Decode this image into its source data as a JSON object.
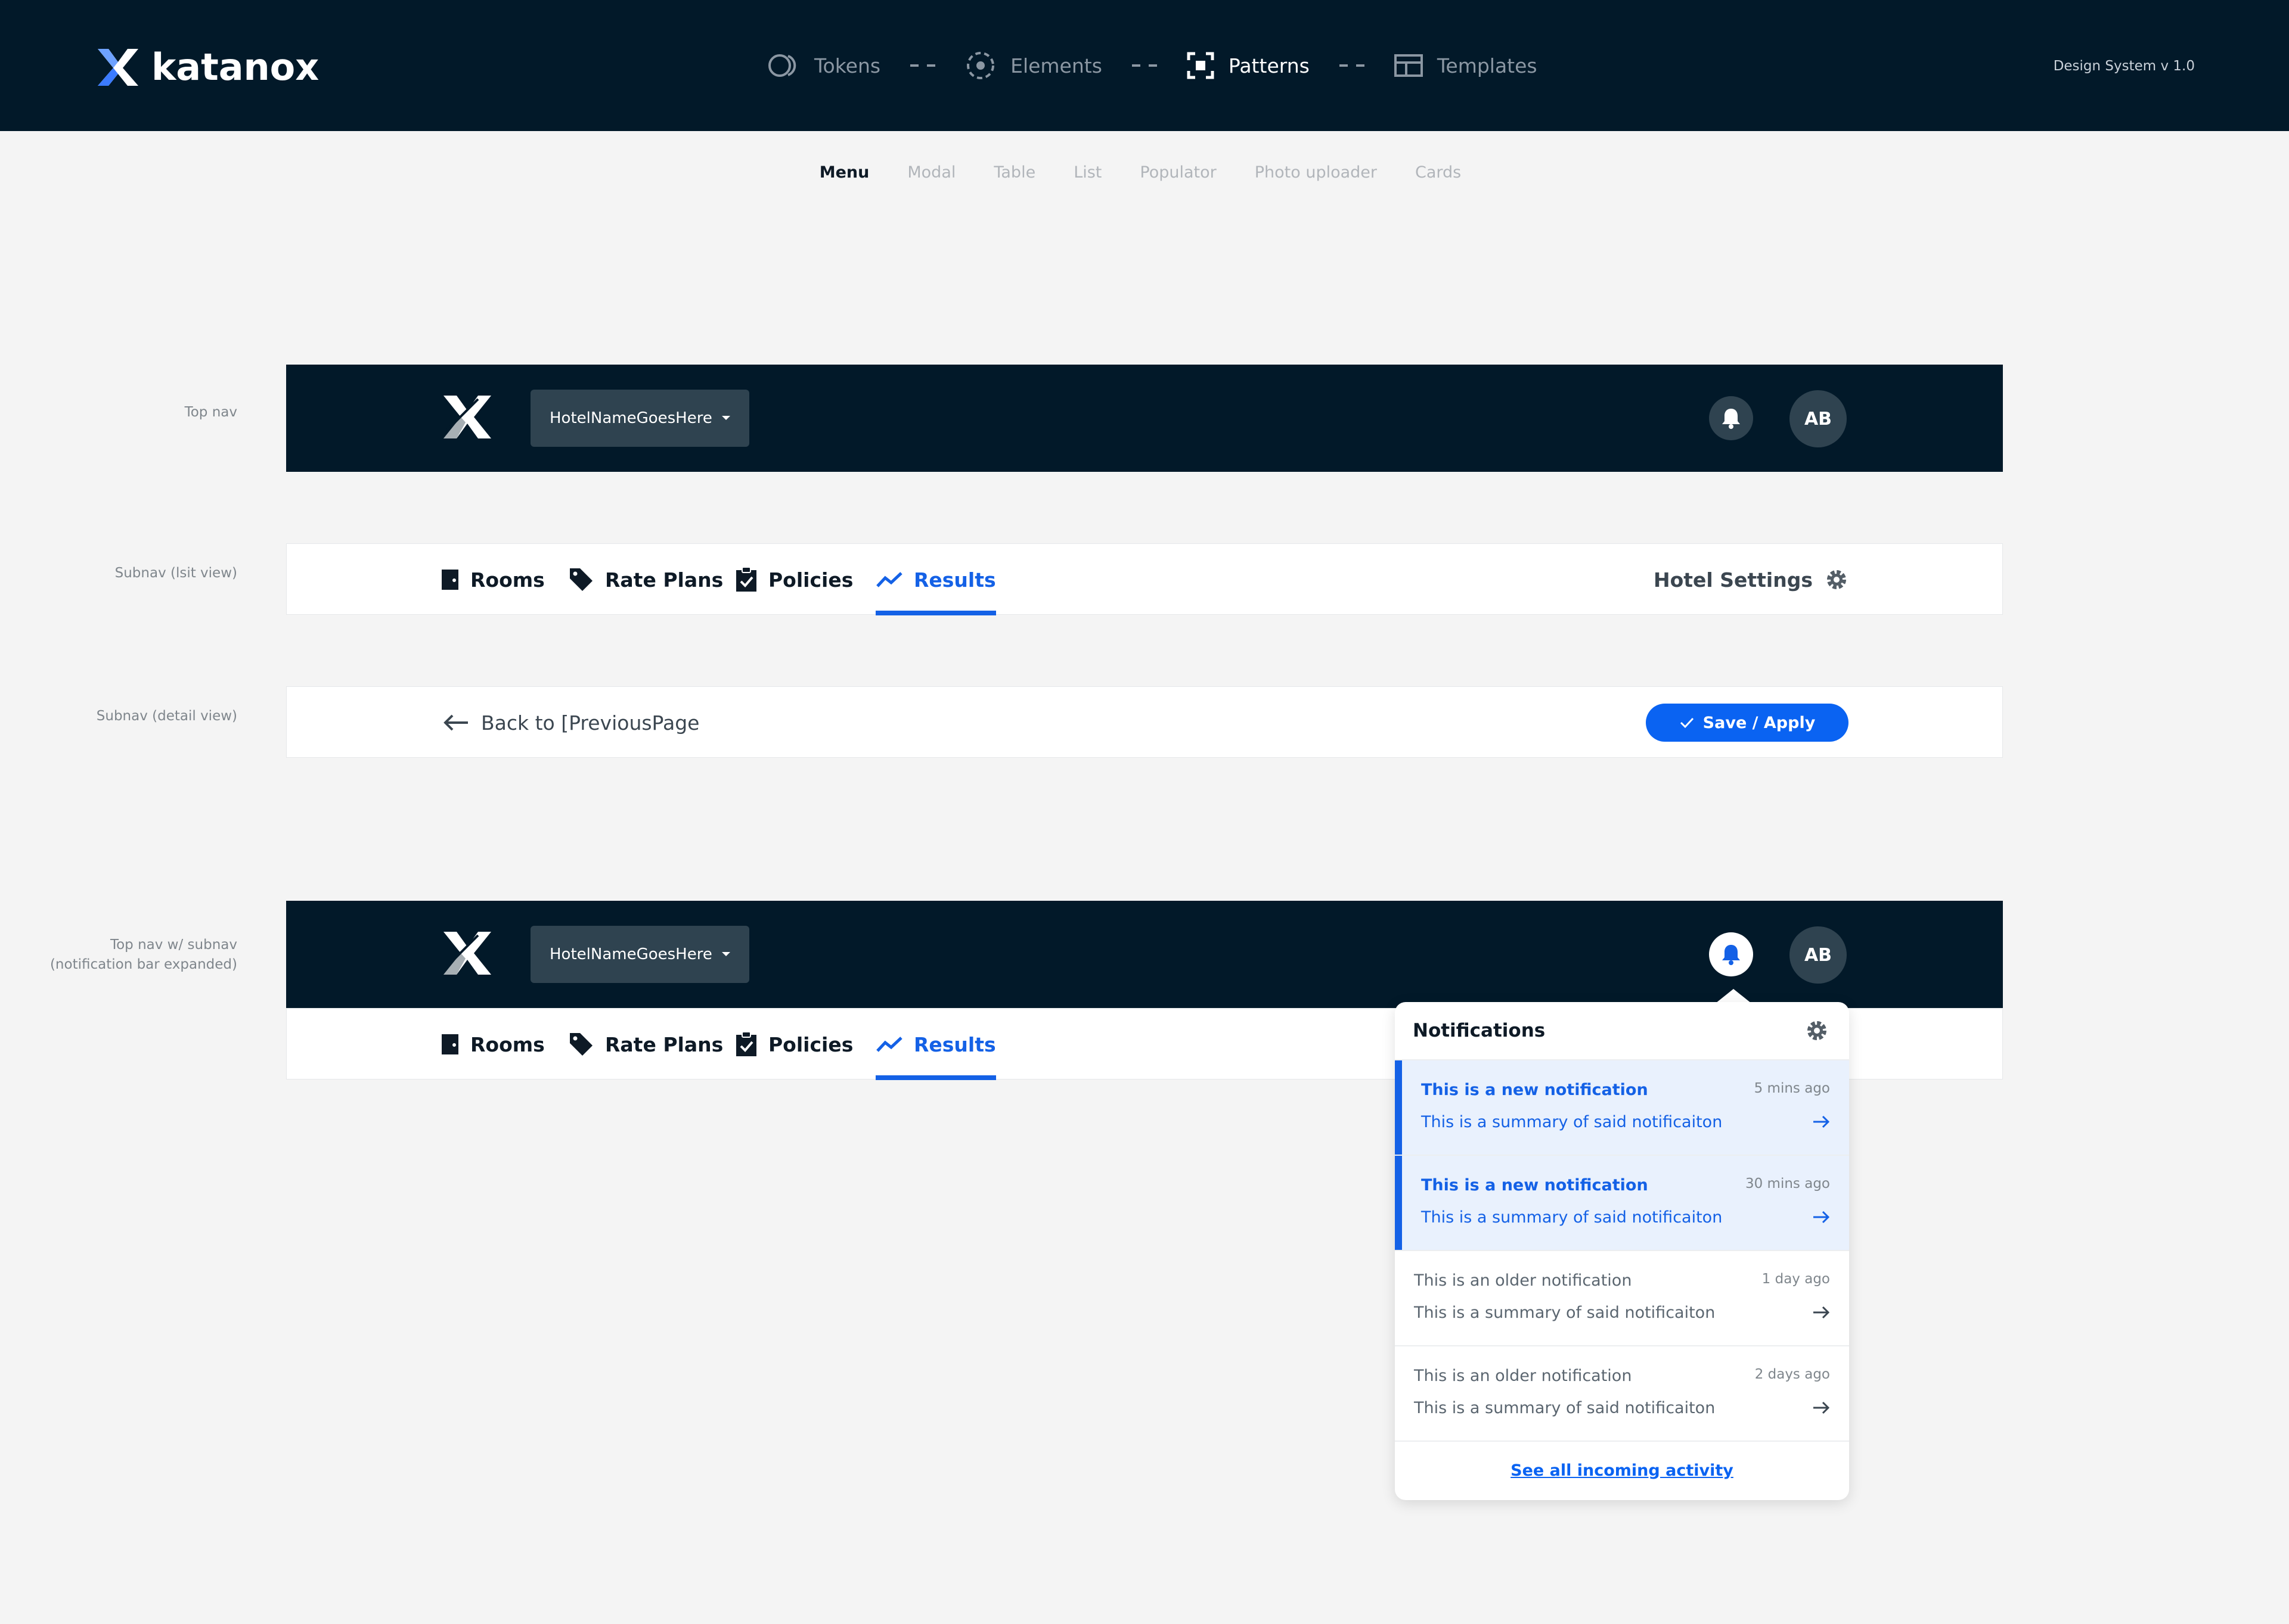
{
  "header": {
    "brand": "katanox",
    "steps": [
      {
        "label": "Tokens",
        "icon": "tokens-icon",
        "active": false
      },
      {
        "label": "Elements",
        "icon": "elements-icon",
        "active": false
      },
      {
        "label": "Patterns",
        "icon": "patterns-icon",
        "active": true
      },
      {
        "label": "Templates",
        "icon": "templates-icon",
        "active": false
      }
    ],
    "version": "Design System v 1.0"
  },
  "pattern_tabs": [
    "Menu",
    "Modal",
    "Table",
    "List",
    "Populator",
    "Photo uploader",
    "Cards"
  ],
  "active_pattern_tab": "Menu",
  "row_labels": {
    "top_nav": "Top nav",
    "subnav_list": "Subnav (lsit view)",
    "subnav_detail": "Subnav (detail view)",
    "top_nav_sub_line1": "Top nav w/ subnav",
    "top_nav_sub_line2": "(notification bar expanded)"
  },
  "top_nav": {
    "hotel_name": "HotelNameGoesHere",
    "avatar_initials": "AB"
  },
  "subnav": {
    "items": [
      {
        "label": "Rooms",
        "icon": "door-icon"
      },
      {
        "label": "Rate Plans",
        "icon": "tag-icon"
      },
      {
        "label": "Policies",
        "icon": "clipboard-check-icon"
      },
      {
        "label": "Results",
        "icon": "trend-icon",
        "active": true
      }
    ],
    "settings_label": "Hotel Settings",
    "back_label": "Back to [PreviousPage",
    "save_label": "Save / Apply"
  },
  "notifications": {
    "title": "Notifications",
    "items": [
      {
        "title": "This is a new notification",
        "summary": "This is a summary of said notificaiton",
        "time": "5 mins ago",
        "unread": true
      },
      {
        "title": "This is a new notification",
        "summary": "This is a summary of said notificaiton",
        "time": "30 mins ago",
        "unread": true
      },
      {
        "title": "This is an older notification",
        "summary": "This is a summary of said notificaiton",
        "time": "1 day ago",
        "unread": false
      },
      {
        "title": "This is an older notification",
        "summary": "This is a summary of said notificaiton",
        "time": "2 days ago",
        "unread": false
      }
    ],
    "see_all": "See all incoming activity"
  },
  "colors": {
    "navy": "#021929",
    "accent_blue": "#1461e6",
    "button_blue": "#0a63f2",
    "unread_bg": "#e9f1fd"
  }
}
